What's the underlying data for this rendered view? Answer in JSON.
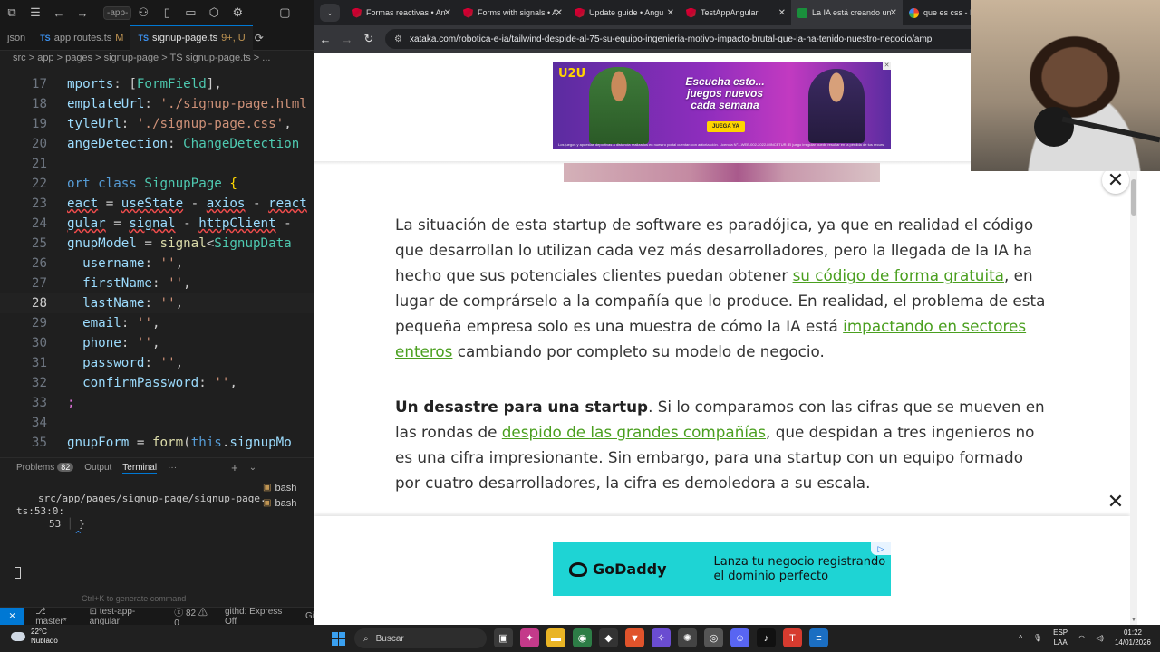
{
  "vscode": {
    "title_cmd": "-app-",
    "tabs": [
      {
        "label": "json",
        "mod": ""
      },
      {
        "label": "app.routes.ts",
        "mod": "M"
      },
      {
        "label": "signup-page.ts",
        "mod": "9+, U"
      }
    ],
    "breadcrumb": "src > app > pages > signup-page > TS signup-page.ts > ...",
    "lines": [
      {
        "n": "17",
        "t": "mports: [FormField],"
      },
      {
        "n": "18",
        "t": "emplateUrl: './signup-page.html"
      },
      {
        "n": "19",
        "t": "tyleUrl: './signup-page.css',"
      },
      {
        "n": "20",
        "t": "angeDetection: ChangeDetection"
      },
      {
        "n": "21",
        "t": ""
      },
      {
        "n": "22",
        "t": "ort class SignupPage {"
      },
      {
        "n": "23",
        "t": "eact = useState - axios - react"
      },
      {
        "n": "24",
        "t": "gular = signal - httpClient -"
      },
      {
        "n": "25",
        "t": "gnupModel = signal<SignupData"
      },
      {
        "n": "26",
        "t": "username: '',"
      },
      {
        "n": "27",
        "t": "firstName: '',"
      },
      {
        "n": "28",
        "t": "lastName: '',"
      },
      {
        "n": "29",
        "t": "email: '',"
      },
      {
        "n": "30",
        "t": "phone: '',"
      },
      {
        "n": "31",
        "t": "password: '',"
      },
      {
        "n": "32",
        "t": "confirmPassword: '',"
      },
      {
        "n": "33",
        "t": ";"
      },
      {
        "n": "34",
        "t": ""
      },
      {
        "n": "35",
        "t": "gnupForm = form(this.signupMo"
      }
    ],
    "panel": {
      "problems": "Problems",
      "problems_count": "82",
      "output": "Output",
      "terminal": "Terminal",
      "more": "···"
    },
    "terminal": {
      "path": "src/app/pages/signup-page/signup-page.",
      "loc": "ts:53:0:",
      "lnum": "53",
      "code": "}",
      "caret": "^",
      "hint": "Ctrl+K to generate command"
    },
    "shells": [
      "bash",
      "bash"
    ],
    "status": {
      "branch": "master*",
      "project": "test-app-angular",
      "problems": "82",
      "warnings": "0",
      "server": "githd: Express Off",
      "extra": "Gi"
    }
  },
  "browser": {
    "tabs": [
      {
        "label": "Formas reactivas • An",
        "fav": "ng"
      },
      {
        "label": "Forms with signals • A",
        "fav": "ng"
      },
      {
        "label": "Update guide • Angu",
        "fav": "ng"
      },
      {
        "label": "TestAppAngular",
        "fav": "ng"
      },
      {
        "label": "La IA está creando un",
        "fav": "xt"
      },
      {
        "label": "que es css - Busca",
        "fav": "g"
      }
    ],
    "url": "xataka.com/robotica-e-ia/tailwind-despide-al-75-su-equipo-ingenieria-motivo-impacto-brutal-que-ia-ha-tenido-nuestro-negocio/amp",
    "ad_top": {
      "logo": "U2U",
      "headline": "Escucha esto... juegos nuevos cada semana",
      "cta": "JUEGA YA",
      "legal": "Los juegos y apuestas deportivas a distancia realizados en nuestro portal cuentan con autorización. Licencia N°1-WEB-002-2022-MINCETUR. El juego irregular puede resultar en la pérdida de tus recursos."
    },
    "article": {
      "p1_a": "La situación de esta startup de software es paradójica, ya que en realidad el código que desarrollan lo utilizan cada vez más desarrolladores, pero la llegada de la IA ha hecho que sus potenciales clientes puedan obtener ",
      "p1_link1": "su código de forma gratuita",
      "p1_b": ", en lugar de comprárselo a la compañía que lo produce. En realidad, el problema de esta pequeña empresa solo es una muestra de cómo la IA está ",
      "p1_link2": "impactando en sectores enteros",
      "p1_c": " cambiando por completo su modelo de negocio.",
      "p2_bold": "Un desastre para una startup",
      "p2_a": ". Si lo comparamos con las cifras que se mueven en las rondas de ",
      "p2_link": "despido de las grandes compañías",
      "p2_b": ", que despidan a tres ingenieros no es una cifra impresionante. Sin embargo, para una startup con un equipo formado por cuatro desarrolladores, la cifra es demoledora a su escala."
    },
    "ad_bottom": {
      "brand": "GoDaddy",
      "text": "Lanza tu negocio registrando el dominio perfecto"
    },
    "close_glyph": "✕"
  },
  "taskbar": {
    "weather_temp": "22°C",
    "weather_desc": "Nublado",
    "search_placeholder": "Buscar",
    "lang_top": "ESP",
    "lang_bottom": "LAA",
    "time": "01:22",
    "date": "14/01/2026"
  }
}
